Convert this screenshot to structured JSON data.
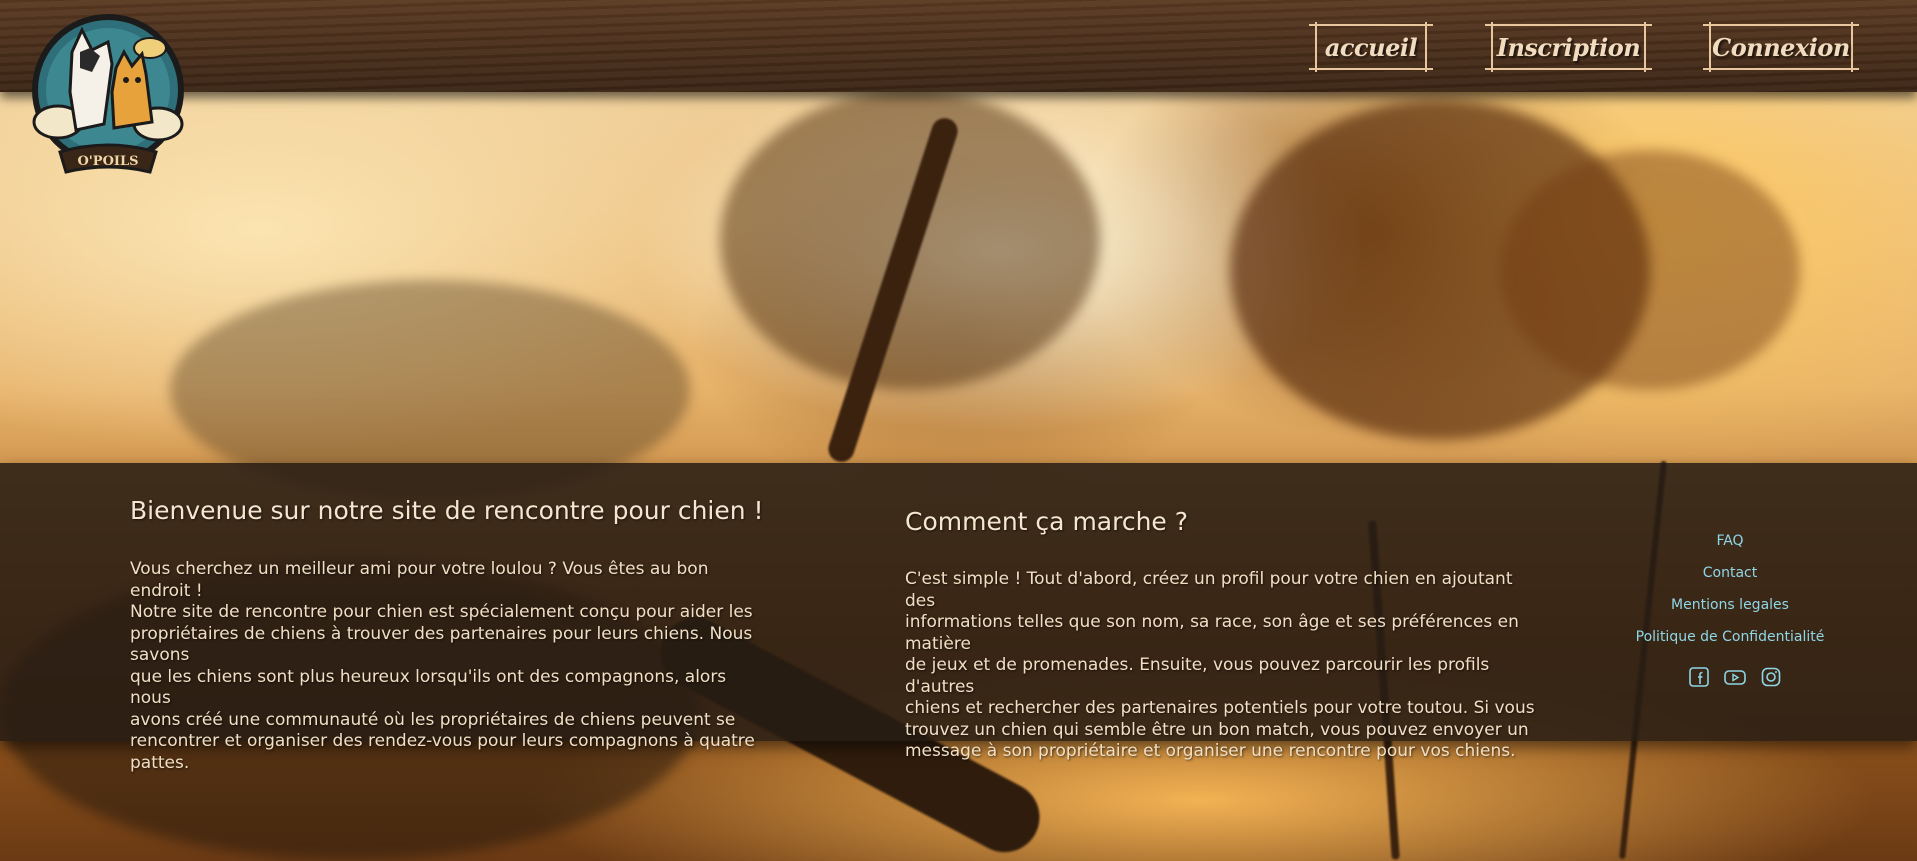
{
  "site": {
    "logo_text": "O'POILS"
  },
  "nav": {
    "home_label": "accueil",
    "signup_label": "Inscription",
    "login_label": "Connexion"
  },
  "welcome": {
    "title": "Bienvenue sur notre site de rencontre pour chien !",
    "lines": [
      "Vous cherchez un meilleur ami pour votre loulou ? Vous êtes au bon endroit !",
      "Notre site de rencontre pour chien est spécialement conçu pour aider les",
      "propriétaires de chiens à trouver des partenaires pour leurs chiens. Nous savons",
      "que les chiens sont plus heureux lorsqu'ils ont des compagnons, alors nous",
      "avons créé une communauté où les propriétaires de chiens peuvent se",
      "rencontrer et organiser des rendez-vous pour leurs compagnons à quatre",
      "pattes."
    ]
  },
  "howto": {
    "title": "Comment ça marche ?",
    "lines": [
      "C'est simple ! Tout d'abord, créez un profil pour votre chien en ajoutant des",
      "informations telles que son nom, sa race, son âge et ses préférences en matière",
      "de jeux et de promenades. Ensuite, vous pouvez parcourir les profils d'autres",
      "chiens et rechercher des partenaires potentiels pour votre toutou. Si vous",
      "trouvez un chien qui semble être un bon match, vous pouvez envoyer un",
      "message à son propriétaire et organiser une rencontre pour vos chiens."
    ]
  },
  "footer": {
    "links": [
      "FAQ",
      "Contact",
      "Mentions legales",
      "Politique de Confidentialité"
    ],
    "socials": [
      "facebook-icon",
      "youtube-icon",
      "instagram-icon"
    ]
  },
  "colors": {
    "accent_link": "#8fd6e6",
    "nav_border": "#e8c79f",
    "band_bg": "#261c14"
  }
}
